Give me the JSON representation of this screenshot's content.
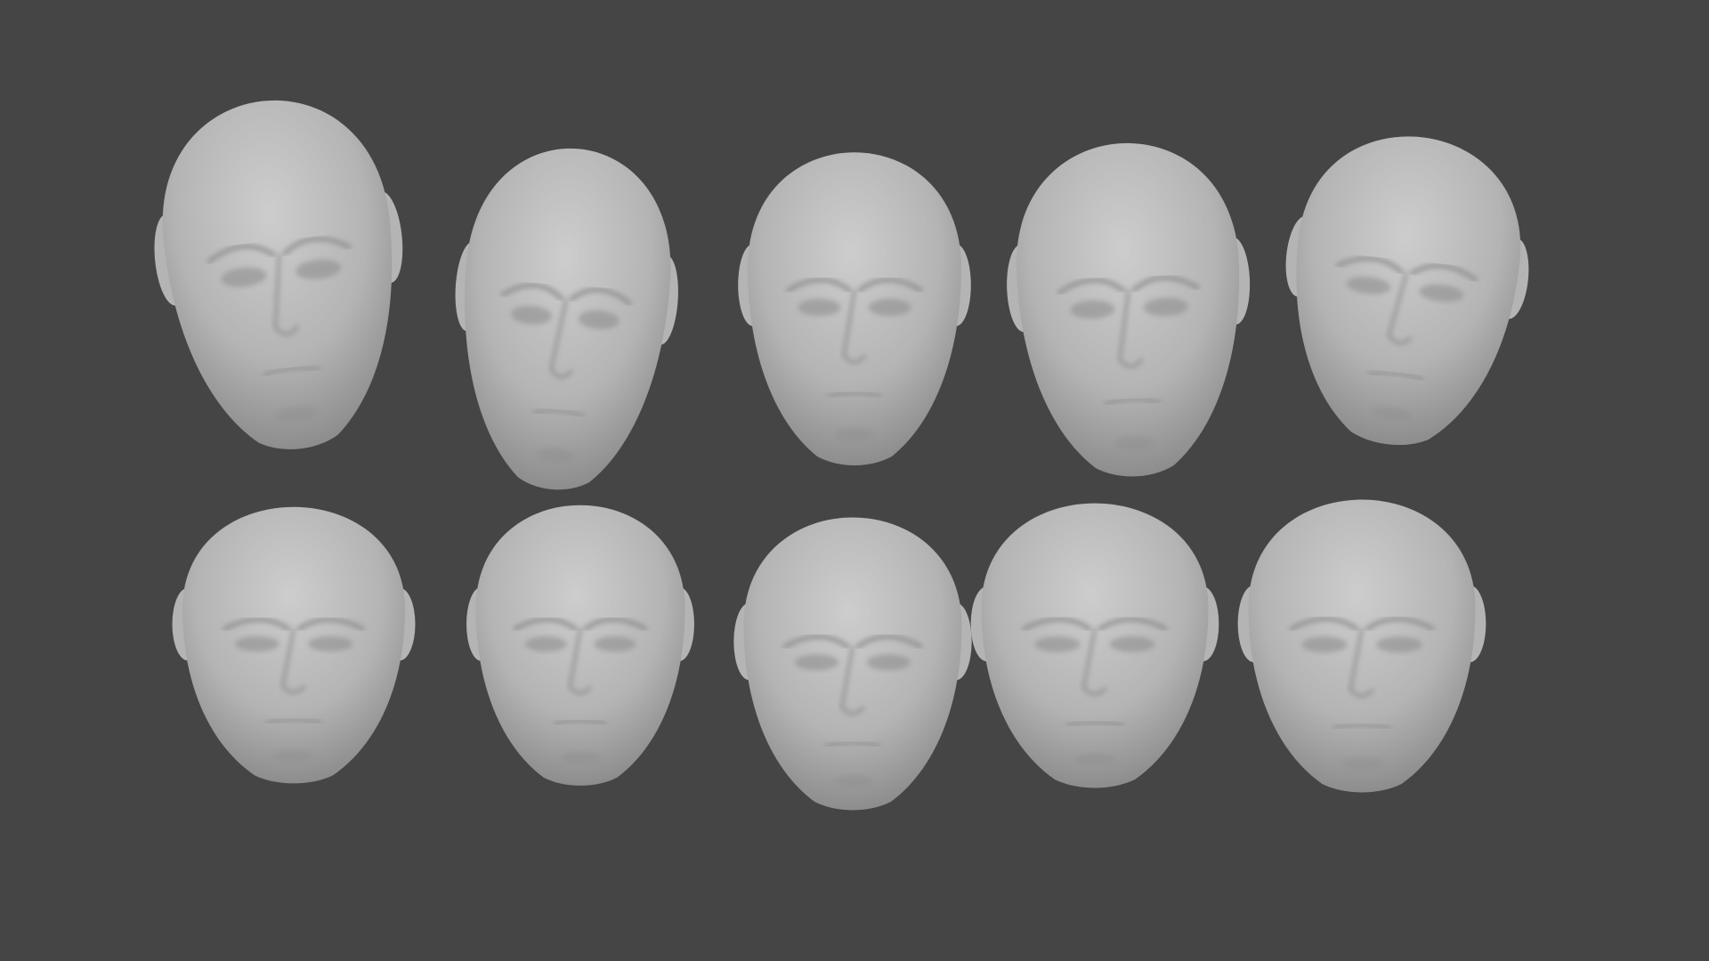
{
  "scene": {
    "background_color": "#454545",
    "sculpt_color": "#b4b4b4",
    "sculpt_shadow_color": "#8a8a8a",
    "sculpt_highlight_color": "#cdcdcd"
  },
  "heads": [
    {
      "row": 1,
      "col": 1
    },
    {
      "row": 1,
      "col": 2
    },
    {
      "row": 1,
      "col": 3
    },
    {
      "row": 1,
      "col": 4
    },
    {
      "row": 1,
      "col": 5
    },
    {
      "row": 2,
      "col": 1
    },
    {
      "row": 2,
      "col": 2
    },
    {
      "row": 2,
      "col": 3
    },
    {
      "row": 2,
      "col": 4
    },
    {
      "row": 2,
      "col": 5
    }
  ]
}
